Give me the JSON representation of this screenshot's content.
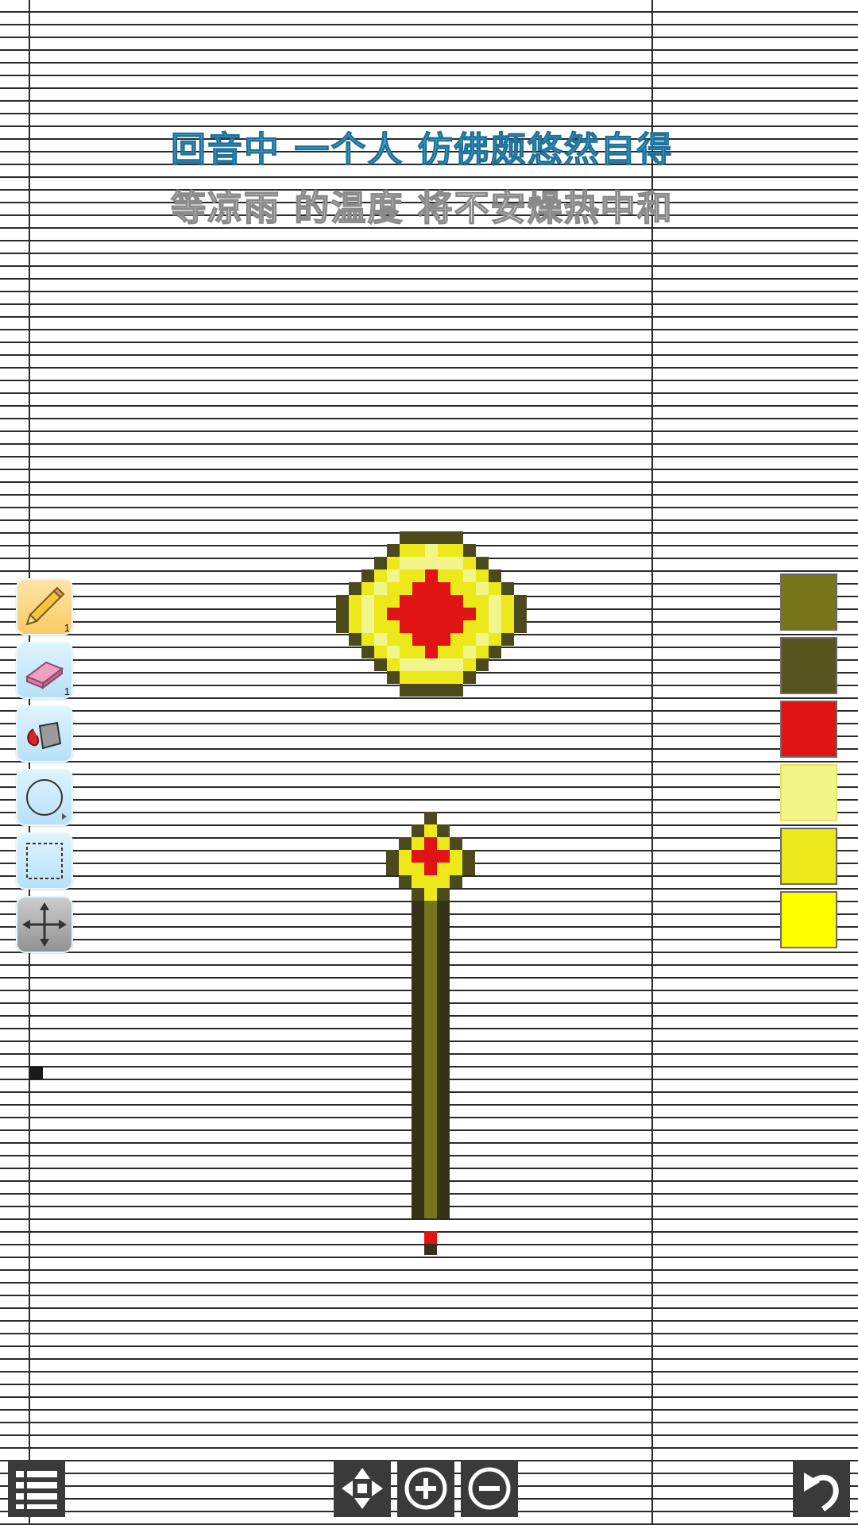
{
  "lyrics": {
    "line1": "回音中 一个人 仿佛颇悠然自得",
    "line2": "等凉雨 的温度 将不安燥热中和"
  },
  "tools": [
    {
      "name": "pencil",
      "badge": "1",
      "active": true
    },
    {
      "name": "eraser",
      "badge": "1",
      "active": false
    },
    {
      "name": "fill-bucket",
      "active": false
    },
    {
      "name": "circle-shape",
      "active": false
    },
    {
      "name": "rect-select",
      "active": false
    },
    {
      "name": "move",
      "active": false
    }
  ],
  "palette": [
    {
      "color": "#77741a",
      "selected": false
    },
    {
      "color": "#58541e",
      "selected": false
    },
    {
      "color": "#e01414",
      "selected": false
    },
    {
      "color": "#f2f58a",
      "selected": true
    },
    {
      "color": "#ece81a",
      "selected": false
    },
    {
      "color": "#ffff00",
      "selected": false
    }
  ],
  "bottom_bar": {
    "menu": "list-icon",
    "pan": "pan-arrows-icon",
    "zoom_in": "zoom-in-icon",
    "zoom_out": "zoom-out-icon",
    "undo": "undo-icon"
  },
  "pixel_colors": {
    "outline": "#4c4a1c",
    "dark_olive": "#77741a",
    "handle_dark": "#35321a",
    "yellow": "#ffff00",
    "gold": "#ece81a",
    "light": "#f2f58a",
    "red": "#e01414"
  }
}
